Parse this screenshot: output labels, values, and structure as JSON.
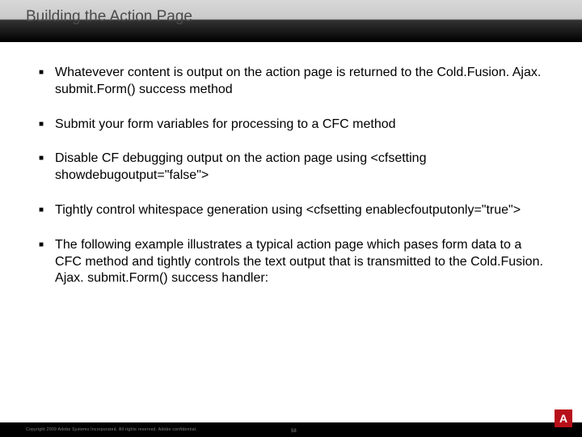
{
  "title": "Building the Action Page",
  "bullets": [
    "Whatevever content is output on the action page is returned to the Cold.Fusion. Ajax. submit.Form() success method",
    "Submit your form variables for processing to a CFC method",
    "Disable CF debugging output on the action page using <cfsetting showdebugoutput=\"false\">",
    "Tightly control whitespace generation using <cfsetting enablecfoutputonly=\"true\">",
    "The following example illustrates a typical action page which pases form data to a CFC method and tightly controls the text output that is transmitted to the Cold.Fusion. Ajax. submit.Form() success handler:"
  ],
  "footer": {
    "copyright": "Copyright 2009 Adobe Systems Incorporated.  All rights reserved.  Adobe confidential.",
    "slide_number": "58",
    "logo_letter": "A"
  }
}
